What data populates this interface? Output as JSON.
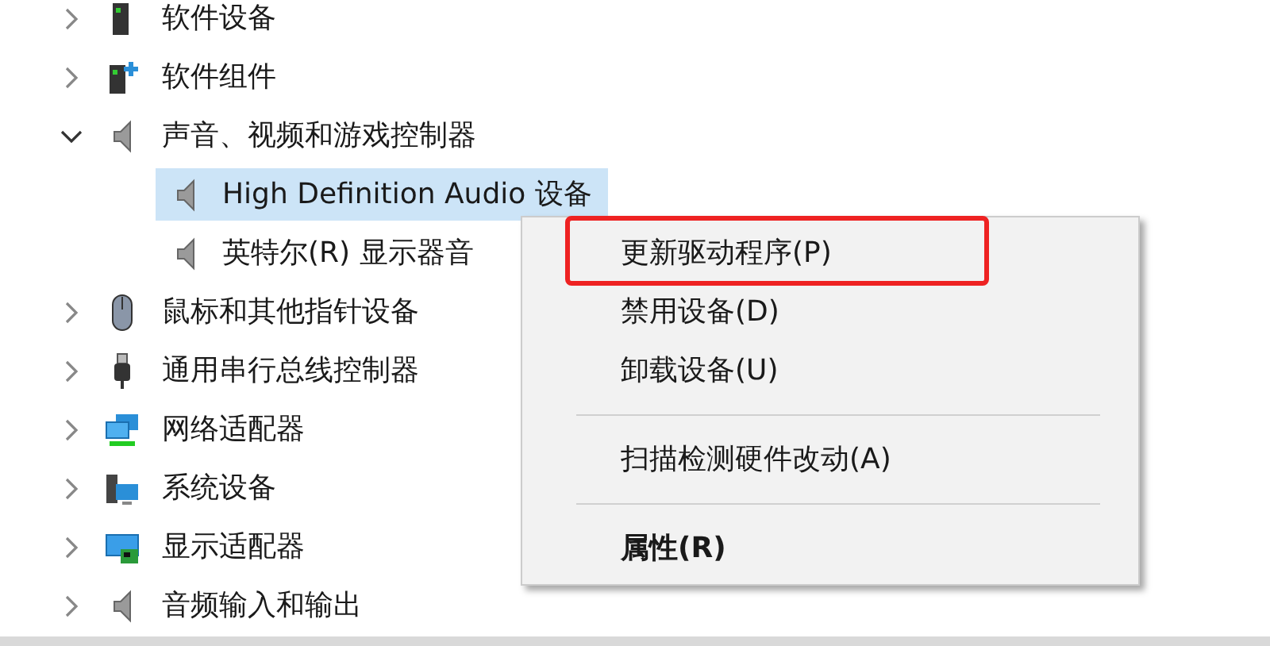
{
  "tree": [
    {
      "label": "软件设备",
      "expanded": false
    },
    {
      "label": "软件组件",
      "expanded": false
    },
    {
      "label": "声音、视频和游戏控制器",
      "expanded": true,
      "children": [
        {
          "label": "High Definition Audio 设备",
          "selected": true
        },
        {
          "label": "英特尔(R) 显示器音",
          "selected": false
        }
      ]
    },
    {
      "label": "鼠标和其他指针设备",
      "expanded": false
    },
    {
      "label": "通用串行总线控制器",
      "expanded": false
    },
    {
      "label": "网络适配器",
      "expanded": false
    },
    {
      "label": "系统设备",
      "expanded": false
    },
    {
      "label": "显示适配器",
      "expanded": false
    },
    {
      "label": "音频输入和输出",
      "expanded": false
    }
  ],
  "context_menu": [
    {
      "kind": "item",
      "label": "更新驱动程序(P)",
      "highlighted": true
    },
    {
      "kind": "item",
      "label": "禁用设备(D)",
      "highlighted": false
    },
    {
      "kind": "item",
      "label": "卸载设备(U)",
      "highlighted": false
    },
    {
      "kind": "separator"
    },
    {
      "kind": "item",
      "label": "扫描检测硬件改动(A)",
      "highlighted": false
    },
    {
      "kind": "separator"
    },
    {
      "kind": "default",
      "label": "属性(R)",
      "highlighted": false
    }
  ]
}
